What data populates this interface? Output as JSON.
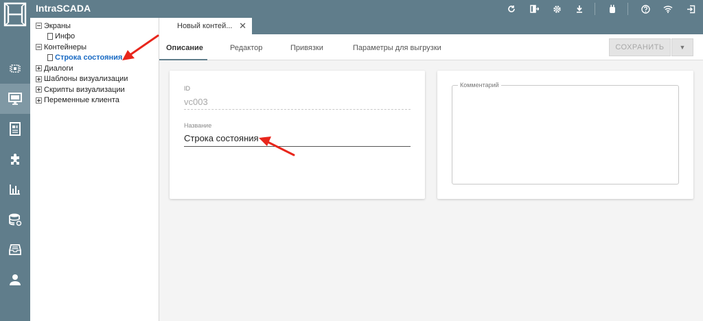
{
  "app": {
    "title": "IntraSCADA"
  },
  "topbar": {
    "icons": [
      "refresh-icon",
      "export-icon",
      "settings-icon",
      "download-icon",
      "plugin-icon",
      "help-icon",
      "wifi-icon",
      "logout-icon"
    ]
  },
  "rail": {
    "items": [
      "chip-icon",
      "monitor-icon",
      "document-icon",
      "puzzle-icon",
      "chart-icon",
      "database-icon",
      "archive-icon",
      "user-icon"
    ],
    "active_index": 1
  },
  "tree": {
    "nodes": [
      {
        "label": "Экраны",
        "toggle": "minus",
        "level": 0
      },
      {
        "label": "Инфо",
        "toggle": "none",
        "level": 1
      },
      {
        "label": "Контейнеры",
        "toggle": "minus",
        "level": 0
      },
      {
        "label": "Строка состояния",
        "toggle": "none",
        "level": 1,
        "selected": true
      },
      {
        "label": "Диалоги",
        "toggle": "plus",
        "level": 0
      },
      {
        "label": "Шаблоны визуализации",
        "toggle": "plus",
        "level": 0
      },
      {
        "label": "Скрипты визуализации",
        "toggle": "plus",
        "level": 0
      },
      {
        "label": "Переменные клиента",
        "toggle": "plus",
        "level": 0
      }
    ]
  },
  "doc_tab": {
    "label": "Новый контей...",
    "close": "✕"
  },
  "subtabs": [
    "Описание",
    "Редактор",
    "Привязки",
    "Параметры для выгрузки"
  ],
  "toolbar": {
    "save_label": "СОХРАНИТЬ",
    "dropdown": "▼"
  },
  "form": {
    "id_label": "ID",
    "id_value": "vc003",
    "name_label": "Название",
    "name_value": "Строка состояния",
    "comment_label": "Комментарий"
  },
  "colors": {
    "bar": "#607d8b",
    "rail_active": "#7f98a4",
    "selected_link": "#1a6bc4",
    "arrow": "#e8261c"
  }
}
